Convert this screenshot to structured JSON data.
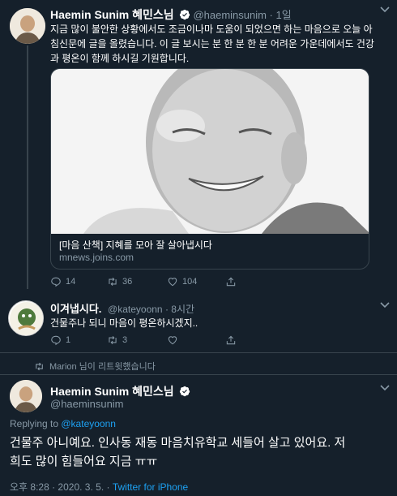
{
  "tweet1": {
    "name": "Haemin Sunim 혜민스님",
    "handle": "@haeminsunim · 1일",
    "text_line1": "지금 많이 불안한 상황에서도 조금이나마 도움이 되었으면 하는 마음으로 오늘 아",
    "text_line2": "침신문에 글을 올렸습니다. 이 글 보시는 분 한 분 한 분 어려운 가운데에서도 건강",
    "text_line3": "과 평온이 함께 하시길 기원합니다.",
    "card_title": "[마음 산책] 지혜를 모아 잘 살아냅시다",
    "card_domain": "mnews.joins.com",
    "replies": "14",
    "retweets": "36",
    "likes": "104"
  },
  "tweet2": {
    "name": "이겨냅시다.",
    "handle": "@kateyoonn · 8시간",
    "text": "건물주나 되니 마음이 평온하시겠지..",
    "replies": "1",
    "retweets": "3"
  },
  "retweet_note": "Marion 님이 리트윗했습니다",
  "tweet3": {
    "name": "Haemin Sunim 혜민스님",
    "handle": "@haeminsunim",
    "replying_prefix": "Replying to ",
    "replying_handle": "@kateyoonn",
    "text_line1": "건물주 아니예요. 인사동 재동 마음치유학교 세들어 살고 있어요. 저",
    "text_line2": "희도 많이 힘들어요 지금 ㅠㅠ",
    "timestamp": "오후 8:28 · 2020. 3. 5. · ",
    "source": "Twitter for iPhone"
  },
  "colors": {
    "background": "#15202b",
    "accent": "#1da1f2",
    "secondary_text": "#8899a6",
    "border": "#38444d"
  },
  "icons": [
    "reply-icon",
    "retweet-icon",
    "like-icon",
    "share-icon",
    "verified-icon",
    "more-icon"
  ]
}
